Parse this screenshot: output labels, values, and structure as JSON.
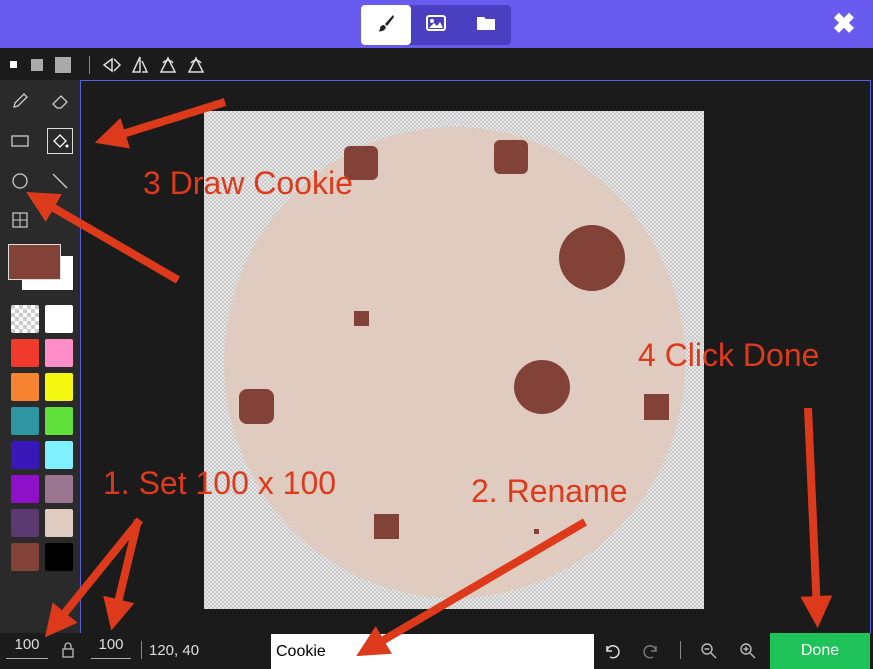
{
  "colors": {
    "accent": "#6a5bf0",
    "done": "#1ec258",
    "annotation": "#dd3a1c",
    "cookie": "#e0cbc0",
    "chip": "#824237"
  },
  "header": {
    "modes": [
      "paint-brush-icon",
      "image-icon",
      "folder-icon"
    ],
    "close_icon": "✖"
  },
  "palette": [
    "transparent",
    "#ffffff",
    "#f03a2e",
    "#ff8ec8",
    "#f58330",
    "#f4f80e",
    "#2e96a2",
    "#5fe03a",
    "#3818b8",
    "#7ff0ff",
    "#8e10c8",
    "#9a7590",
    "#5a3870",
    "#e0cbc0",
    "#824237",
    "#000000"
  ],
  "bottom": {
    "width_value": "100",
    "height_value": "100",
    "coords": "120, 40",
    "name_value": "Cookie",
    "done_label": "Done"
  },
  "annotations": {
    "step3": "3 Draw Cookie",
    "step4": "4 Click Done",
    "step1": "1. Set 100 x 100",
    "step2": "2. Rename"
  }
}
